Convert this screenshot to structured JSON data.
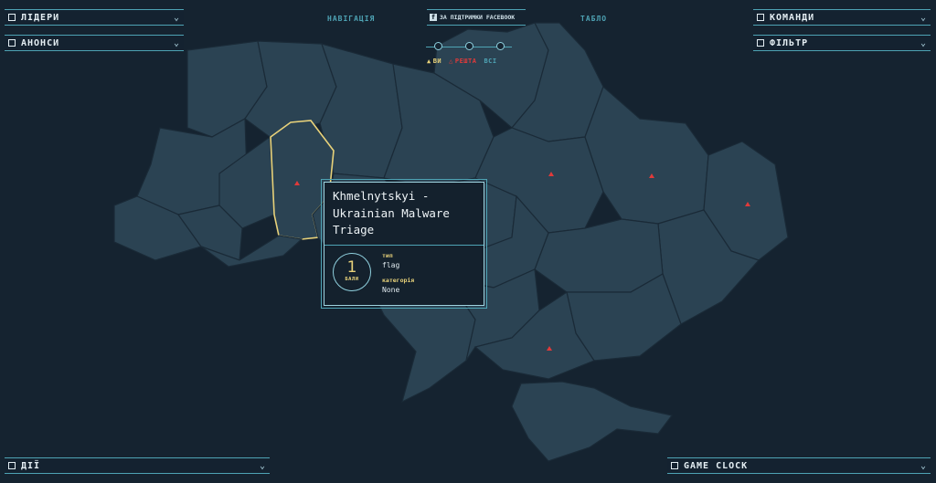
{
  "panels": {
    "leaders": "ЛІДЕРИ",
    "announcements": "АНОНСИ",
    "teams": "КОМАНДИ",
    "filter": "ФІЛЬТР",
    "actions": "ДІЇ",
    "game_clock": "GAME CLOCK"
  },
  "top_nav": {
    "navigation": "НАВІГАЦІЯ",
    "facebook": "ЗА ПІДТРИМКИ FACEBOOK",
    "facebook_icon": "f",
    "scoreboard": "ТАБЛО"
  },
  "legend": {
    "you": "ВИ",
    "rest": "РЕШТА",
    "all": "ВСІ",
    "you_color": "#e8d27a",
    "rest_color": "#e03a3a",
    "all_color": "#4ea3b4"
  },
  "popup": {
    "title": "Khmelnytskyi - Ukrainian Malware Triage",
    "points_value": "1",
    "points_label": "БАЛИ",
    "type_label": "тип",
    "type_value": "flag",
    "category_label": "категорія",
    "category_value": "None"
  },
  "colors": {
    "background": "#152330",
    "region": "#2b4353",
    "accent": "#4ea3b4",
    "highlight": "#e8d27a",
    "marker": "#e03a3a"
  }
}
